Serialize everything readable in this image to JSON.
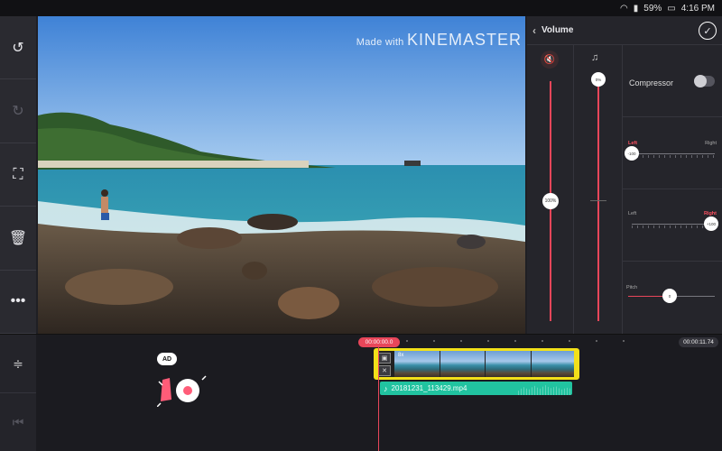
{
  "status_bar": {
    "battery": "59%",
    "time": "4:16 PM"
  },
  "left_toolbar": {
    "items": [
      {
        "icon": "undo-icon",
        "glyph": "↺",
        "enabled": true
      },
      {
        "icon": "redo-icon",
        "glyph": "↻",
        "enabled": false
      },
      {
        "icon": "fullscreen-icon",
        "glyph": "⛶",
        "enabled": true
      },
      {
        "icon": "delete-icon",
        "glyph": "🗑",
        "enabled": true
      },
      {
        "icon": "more-icon",
        "glyph": "•••",
        "enabled": true
      }
    ]
  },
  "preview": {
    "watermark_prefix": "Made with",
    "watermark_brand": "KINEMASTER"
  },
  "volume_panel": {
    "title": "Volume",
    "clip_volume": "100%",
    "clip_volume_level": 1.0,
    "fx_volume": "0%",
    "fx_volume_level": 0.0,
    "compressor_label": "Compressor",
    "compressor_on": false,
    "pan_row1": {
      "left": "Left",
      "right": "Right",
      "value": "-100",
      "active": "left"
    },
    "pan_row2": {
      "left": "Left",
      "right": "Right",
      "value": "+100",
      "active": "right"
    },
    "pitch_label": "Pitch",
    "pitch_value": "0"
  },
  "timeline": {
    "tools": [
      {
        "icon": "timeline-expand-icon",
        "glyph": "≑",
        "enabled": true
      },
      {
        "icon": "jump-to-start-icon",
        "glyph": "⏮",
        "enabled": false
      }
    ],
    "ad_badge": "AD",
    "current_time": "00:00:00.0",
    "total_time": "00:00:11.74",
    "clip_label": "8x",
    "audio_clip_label": "20181231_113429.mp4"
  },
  "colors": {
    "accent": "#e8465a",
    "clip_border": "#f2e019",
    "audio_clip": "#21c3a0"
  }
}
